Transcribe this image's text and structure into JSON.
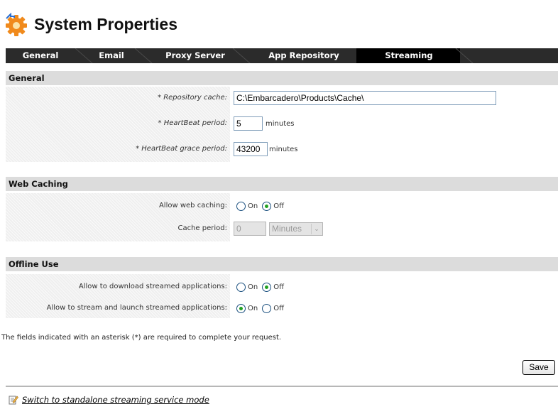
{
  "page": {
    "title": "System Properties"
  },
  "tabs": [
    {
      "label": "General",
      "active": false
    },
    {
      "label": "Email",
      "active": false
    },
    {
      "label": "Proxy Server",
      "active": false
    },
    {
      "label": "App Repository",
      "active": false
    },
    {
      "label": "Streaming",
      "active": true
    }
  ],
  "sections": {
    "general": {
      "title": "General",
      "repository_cache": {
        "label": "* Repository cache:",
        "value": "C:\\Embarcadero\\Products\\Cache\\"
      },
      "heartbeat_period": {
        "label": "* HeartBeat period:",
        "value": "5",
        "unit": "minutes"
      },
      "heartbeat_grace": {
        "label": "* HeartBeat grace period:",
        "value": "43200",
        "unit": "minutes"
      }
    },
    "web_caching": {
      "title": "Web Caching",
      "allow": {
        "label": "Allow web caching:",
        "on_label": "On",
        "off_label": "Off",
        "selected": "Off"
      },
      "cache_period": {
        "label": "Cache period:",
        "value": "0",
        "unit_selected": "Minutes"
      }
    },
    "offline_use": {
      "title": "Offline Use",
      "allow_download": {
        "label": "Allow to download streamed applications:",
        "on_label": "On",
        "off_label": "Off",
        "selected": "Off"
      },
      "allow_stream": {
        "label": "Allow to stream and launch streamed applications:",
        "on_label": "On",
        "off_label": "Off",
        "selected": "On"
      }
    }
  },
  "note": "The fields indicated with an asterisk (*) are required to complete your request.",
  "save_label": "Save",
  "footer_link": "Switch to standalone streaming service mode",
  "colors": {
    "tab_bar": "#2b2b2b",
    "tab_active": "#000000",
    "section_bar": "#dcdcdc",
    "radio_dot": "#21a121"
  }
}
